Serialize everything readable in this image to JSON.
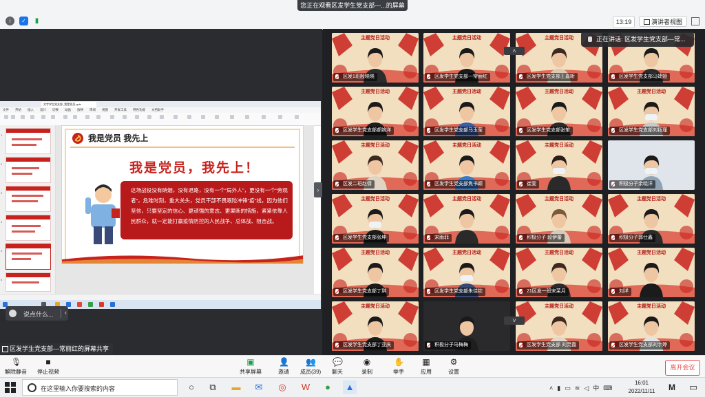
{
  "window": {
    "sharing_banner": "您正在观看区发学生党支部---...的屏幕",
    "time_display": "13:19",
    "view_mode": "演讲者视图"
  },
  "shared_window": {
    "tab_title": "文字学生党支部_我是党员.pptx",
    "menu_items": [
      "文件",
      "开始",
      "插入",
      "设计",
      "切换",
      "动画",
      "放映",
      "审阅",
      "视图",
      "开发工具",
      "特色功能",
      "文档助手"
    ],
    "thumb_numbers": [
      "1",
      "2",
      "3",
      "4",
      "5",
      "6"
    ],
    "slide": {
      "header_title": "我是党员 我先上",
      "big_title": "我是党员，我先上！",
      "body": "这场战役没有硝烟，没有退路，没有一个“局外人”，更没有一个“旁观者”，危难时刻，重大关头，党员干部不畏艰险冲锋“疫”线，因为他们坚信，只要坚定的信心、更顽强的意志、更果断的措施，紧紧依靠人民群众，就一定能打赢疫情防控的人民战争、总体战、阻击战。"
    }
  },
  "chat_pill": {
    "placeholder": "说点什么..."
  },
  "speaking_toast": "正在讲话: 区发学生党支部---常...",
  "share_label": "区发学生党支部---常丽红的屏幕共享",
  "tile_header": "主题党日活动",
  "participants": [
    {
      "name": "区发1班殷晓晓",
      "bg": "#f2dfbf",
      "shirt": "#2c2c2c",
      "hair": "#1a1a1a",
      "mask": false
    },
    {
      "name": "区发学生党支部---常丽红",
      "bg": "#f2dfbf",
      "shirt": "#1b1b1b",
      "hair": "#1a1a1a",
      "mask": false
    },
    {
      "name": "区发学生党支部王嘉昕",
      "bg": "#f2dfbf",
      "shirt": "#d9c8b4",
      "hair": "#3b2a22",
      "mask": false
    },
    {
      "name": "区发学生党支部马婕娅",
      "bg": "#f2dfbf",
      "shirt": "#2b2b2b",
      "hair": "#1a1a1a",
      "mask": false
    },
    {
      "name": "区发学生党支部郝婉洋",
      "bg": "#f2dfbf",
      "shirt": "#1e1e1e",
      "hair": "#1a1a1a",
      "mask": false
    },
    {
      "name": "区发学生党支部马玉莹",
      "bg": "#f2dfbf",
      "shirt": "#3a5ea8",
      "hair": "#1a1a1a",
      "mask": false
    },
    {
      "name": "区发学生党支部张笙",
      "bg": "#f2dfbf",
      "shirt": "#2b2b2b",
      "hair": "#1a1a1a",
      "mask": false
    },
    {
      "name": "区发学生党支部刘钰瑾",
      "bg": "#f2dfbf",
      "shirt": "#c9c9c9",
      "hair": "#1a1a1a",
      "mask": true
    },
    {
      "name": "区发二班赵倩",
      "bg": "#f2dfbf",
      "shirt": "#e1d3c3",
      "hair": "#3a2a20",
      "mask": false
    },
    {
      "name": "区发学生党支部焦书颖",
      "bg": "#f2dfbf",
      "shirt": "#3a78c6",
      "hair": "#1a1a1a",
      "mask": false
    },
    {
      "name": "崔雯",
      "bg": "#f2dfbf",
      "shirt": "#2a2a2a",
      "hair": "#2a1e18",
      "mask": true
    },
    {
      "name": "积极分子余晓洋",
      "bg": "#dfe5ea",
      "shirt": "#8fa3b5",
      "hair": "#1a1a1a",
      "mask": true
    },
    {
      "name": "区发学生党支部张坤",
      "bg": "#f2dfbf",
      "shirt": "#1b1b1b",
      "hair": "#1a1a1a",
      "mask": true
    },
    {
      "name": "宋雨菲",
      "bg": "#f2dfbf",
      "shirt": "#2a2a2a",
      "hair": "#1a1a1a",
      "mask": false
    },
    {
      "name": "积极分子 段伊蕾",
      "bg": "#f2dfbf",
      "shirt": "#d8c9b9",
      "hair": "#7a5a3a",
      "mask": false
    },
    {
      "name": "积极分子郭仕鑫",
      "bg": "#f2dfbf",
      "shirt": "#2b2b2b",
      "hair": "#1a1a1a",
      "mask": false
    },
    {
      "name": "区发学生党支部丁琪",
      "bg": "#f2dfbf",
      "shirt": "#1b1b1b",
      "hair": "#1a1a1a",
      "mask": false
    },
    {
      "name": "区发学生党支部朱佳钦",
      "bg": "#f2dfbf",
      "shirt": "#384a74",
      "hair": "#1a1a1a",
      "mask": true
    },
    {
      "name": "21区发一班宋茉月",
      "bg": "#f2dfbf",
      "shirt": "#2b2b2b",
      "hair": "#3a2a20",
      "mask": false
    },
    {
      "name": "刘洋",
      "bg": "#f2dfbf",
      "shirt": "#1b1b1b",
      "hair": "#1a1a1a",
      "mask": false
    },
    {
      "name": "区发学生党支部丁亚庆",
      "bg": "#f2dfbf",
      "shirt": "#1b1b1b",
      "hair": "#1a1a1a",
      "mask": false
    },
    {
      "name": "积极分子马梅梅",
      "bg": "#2a2a2c",
      "shirt": "#1e1e1e",
      "hair": "#1a1a1a",
      "mask": false
    },
    {
      "name": "区发学生党支部 刘灵霞",
      "bg": "#f2dfbf",
      "shirt": "#e4d6c8",
      "hair": "#3a2a20",
      "mask": false
    },
    {
      "name": "区发学生党支部刘宇婷",
      "bg": "#f2dfbf",
      "shirt": "#e3e3e3",
      "hair": "#1a1a1a",
      "mask": false
    }
  ],
  "controls": {
    "unmute": "解除静音",
    "stop_video": "停止视频",
    "share_screen": "共享屏幕",
    "invite": "邀请",
    "members": "成员(39)",
    "chat": "聊天",
    "record": "录制",
    "raise_hand": "举手",
    "apps": "应用",
    "settings": "设置",
    "end_meeting": "离开会议"
  },
  "taskbar": {
    "search_placeholder": "在这里输入你要搜索的内容",
    "time": "16:01",
    "date": "2022/11/11",
    "ime": "中"
  },
  "colors": {
    "accent": "#1a73e8",
    "party_red": "#c8221c",
    "end_red": "#e24b4b"
  }
}
